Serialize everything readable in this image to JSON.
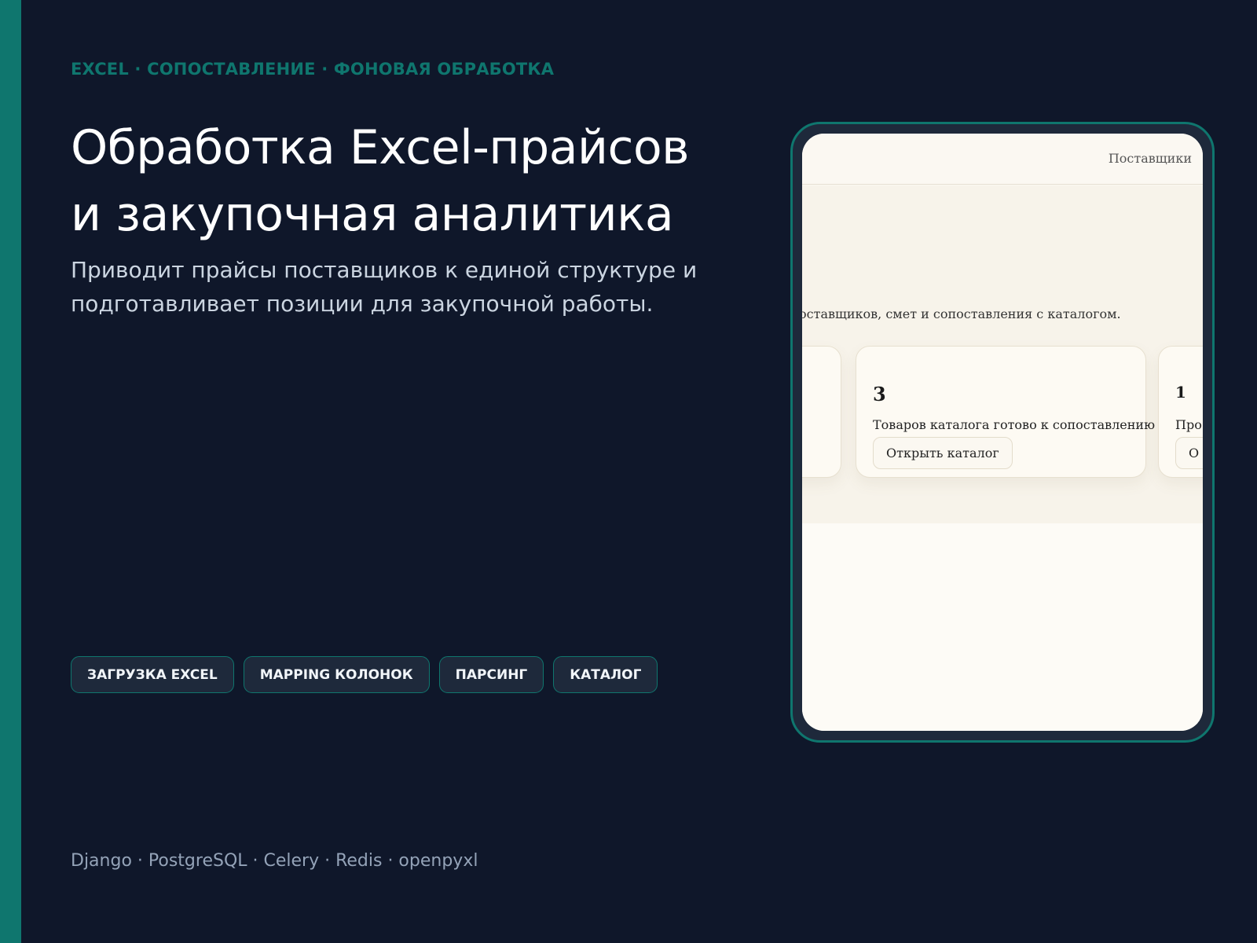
{
  "eyebrow": "EXCEL · СОПОСТАВЛЕНИЕ · ФОНОВАЯ ОБРАБОТКА",
  "title_line1": "Обработка Excel-прайсов",
  "title_line2": "и закупочная аналитика",
  "subtitle_line1": "Приводит прайсы поставщиков к единой структуре и",
  "subtitle_line2": "подготавливает позиции для закупочной работы.",
  "chips": [
    "ЗАГРУЗКА EXCEL",
    "MAPPING КОЛОНОК",
    "ПАРСИНГ",
    "КАТАЛОГ"
  ],
  "stack": "Django · PostgreSQL · Celery · Redis · openpyxl",
  "colors": {
    "background": "#0f172a",
    "accent": "#0f766e",
    "chip_bg": "#1e293b",
    "screen_bg": "#fbf8f1"
  },
  "mockup": {
    "nav_link": "Поставщики",
    "intro": "оставщиков, смет и сопоставления с каталогом.",
    "card_mid": {
      "value": "3",
      "label": "Товаров каталога готово к сопоставлению",
      "button": "Открыть каталог"
    },
    "card_right": {
      "value": "1",
      "label": "Про",
      "button": "О"
    }
  }
}
